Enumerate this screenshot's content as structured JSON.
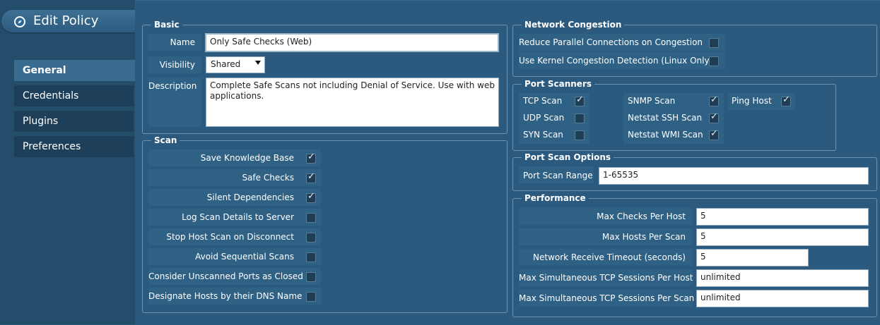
{
  "header": {
    "title": "Edit Policy",
    "icon": "compass-icon"
  },
  "nav": {
    "general": "General",
    "credentials": "Credentials",
    "plugins": "Plugins",
    "preferences": "Preferences"
  },
  "basic": {
    "legend": "Basic",
    "name_label": "Name",
    "name_value": "Only Safe Checks (Web)",
    "visibility_label": "Visibility",
    "visibility_value": "Shared",
    "description_label": "Description",
    "description_value": "Complete Safe Scans not including Denial of Service.  Use with web applications."
  },
  "scan": {
    "legend": "Scan",
    "options": [
      {
        "label": "Save Knowledge Base",
        "checked": true
      },
      {
        "label": "Safe Checks",
        "checked": true
      },
      {
        "label": "Silent Dependencies",
        "checked": true
      },
      {
        "label": "Log Scan Details to Server",
        "checked": false
      },
      {
        "label": "Stop Host Scan on Disconnect",
        "checked": false
      },
      {
        "label": "Avoid Sequential Scans",
        "checked": false
      },
      {
        "label": "Consider Unscanned Ports as Closed",
        "checked": false
      },
      {
        "label": "Designate Hosts by their DNS Name",
        "checked": false
      }
    ]
  },
  "network_congestion": {
    "legend": "Network Congestion",
    "reduce_label": "Reduce Parallel Connections on Congestion",
    "reduce_checked": false,
    "kernel_label": "Use Kernel Congestion Detection (Linux Only)",
    "kernel_checked": false
  },
  "port_scanners": {
    "legend": "Port Scanners",
    "tcp": "TCP Scan",
    "tcp_checked": true,
    "udp": "UDP Scan",
    "udp_checked": false,
    "syn": "SYN Scan",
    "syn_checked": false,
    "snmp": "SNMP Scan",
    "snmp_checked": true,
    "netstat_ssh": "Netstat SSH Scan",
    "netstat_ssh_checked": true,
    "netstat_wmi": "Netstat WMI Scan",
    "netstat_wmi_checked": true,
    "ping": "Ping Host",
    "ping_checked": true
  },
  "port_scan_options": {
    "legend": "Port Scan Options",
    "range_label": "Port Scan Range",
    "range_value": "1-65535"
  },
  "performance": {
    "legend": "Performance",
    "max_checks_label": "Max Checks Per Host",
    "max_checks_value": "5",
    "max_hosts_label": "Max Hosts Per Scan",
    "max_hosts_value": "5",
    "timeout_label": "Network Receive Timeout (seconds)",
    "timeout_value": "5",
    "tcp_host_label": "Max Simultaneous TCP Sessions Per Host",
    "tcp_host_value": "unlimited",
    "tcp_scan_label": "Max Simultaneous TCP Sessions Per Scan",
    "tcp_scan_value": "unlimited"
  },
  "colors": {
    "background": "#2a5679",
    "panel": "#2c5a7e",
    "nav_active": "#3b6b8f",
    "nav_inactive": "#1d3f5a"
  }
}
